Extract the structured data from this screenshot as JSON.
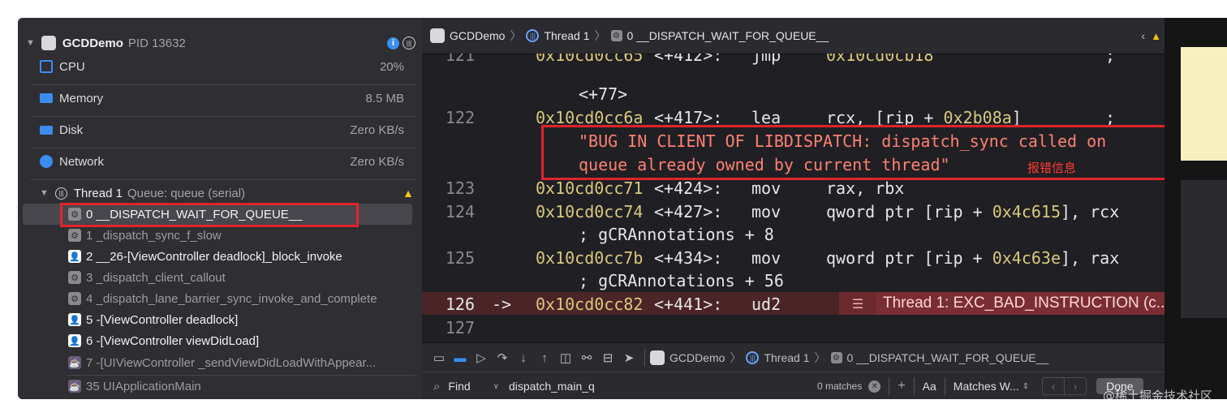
{
  "navigator": {
    "process_name": "GCDDemo",
    "process_pid": "PID 13632",
    "gauges": [
      {
        "label": "CPU",
        "value": "20%"
      },
      {
        "label": "Memory",
        "value": "8.5 MB"
      },
      {
        "label": "Disk",
        "value": "Zero KB/s"
      },
      {
        "label": "Network",
        "value": "Zero KB/s"
      }
    ],
    "thread_title": "Thread 1",
    "thread_queue": "Queue: queue (serial)",
    "frames": [
      {
        "text": "0 __DISPATCH_WAIT_FOR_QUEUE__",
        "icon": "gear-icon",
        "bright": true
      },
      {
        "text": "1 _dispatch_sync_f_slow",
        "icon": "gear-icon",
        "bright": false
      },
      {
        "text": "2 __26-[ViewController deadlock]_block_invoke",
        "icon": "user-icon",
        "bright": true
      },
      {
        "text": "3 _dispatch_client_callout",
        "icon": "gear-icon",
        "bright": false
      },
      {
        "text": "4 _dispatch_lane_barrier_sync_invoke_and_complete",
        "icon": "gear-icon",
        "bright": false
      },
      {
        "text": "5 -[ViewController deadlock]",
        "icon": "user-icon",
        "bright": true
      },
      {
        "text": "6 -[ViewController viewDidLoad]",
        "icon": "user-icon",
        "bright": true
      },
      {
        "text": "7 -[UIViewController _sendViewDidLoadWithAppear...",
        "icon": "cup-icon",
        "bright": false
      },
      {
        "text": "35 UIApplicationMain",
        "icon": "cup-icon",
        "bright": false
      }
    ]
  },
  "jump_bar": {
    "app": "GCDDemo",
    "thread": "Thread 1",
    "frame": "0 __DISPATCH_WAIT_FOR_QUEUE__"
  },
  "code": {
    "lines": [
      {
        "num": "121",
        "addr": "0x10cd0cc65",
        "off": "<+412>:",
        "op": "jmp",
        "arg": "0x10cd0cb18",
        "tail": ";"
      },
      {
        "cont": "<+77>"
      },
      {
        "num": "122",
        "addr": "0x10cd0cc6a",
        "off": "<+417>:",
        "op": "lea",
        "arg": "rcx, [rip + 0x2b08a]",
        "tail": ";"
      },
      {
        "str1": "\"BUG IN CLIENT OF LIBDISPATCH: dispatch_sync called on"
      },
      {
        "str2": "queue already owned by current thread\""
      },
      {
        "num": "123",
        "addr": "0x10cd0cc71",
        "off": "<+424>:",
        "op": "mov",
        "arg": "rax, rbx"
      },
      {
        "num": "124",
        "addr": "0x10cd0cc74",
        "off": "<+427>:",
        "op": "mov",
        "arg": "qword ptr [rip + 0x4c615], rcx"
      },
      {
        "cont": "; gCRAnnotations + 8"
      },
      {
        "num": "125",
        "addr": "0x10cd0cc7b",
        "off": "<+434>:",
        "op": "mov",
        "arg": "qword ptr [rip + 0x4c63e], rax"
      },
      {
        "cont": "; gCRAnnotations + 56"
      },
      {
        "num": "126",
        "arrow": "->",
        "addr": "0x10cd0cc82",
        "off": "<+441>:",
        "op": "ud2"
      },
      {
        "num": "127"
      }
    ],
    "annotation": "报错信息",
    "exception_banner": "Thread 1: EXC_BAD_INSTRUCTION (c..."
  },
  "debug_bar": {
    "app": "GCDDemo",
    "thread": "Thread 1",
    "frame": "0 __DISPATCH_WAIT_FOR_QUEUE__"
  },
  "find_bar": {
    "mode": "Find",
    "query": "dispatch_main_q",
    "matches": "0 matches",
    "case_label": "Aa",
    "match_mode": "Matches W...",
    "done_label": "Done"
  },
  "colors": {
    "accent_blue": "#3b8ef0",
    "error_red": "#e0242c",
    "warning_yellow": "#f5c518",
    "address_yellow": "#d9c97c",
    "string_red": "#ff8170"
  },
  "watermark": "@稀土掘金技术社区"
}
